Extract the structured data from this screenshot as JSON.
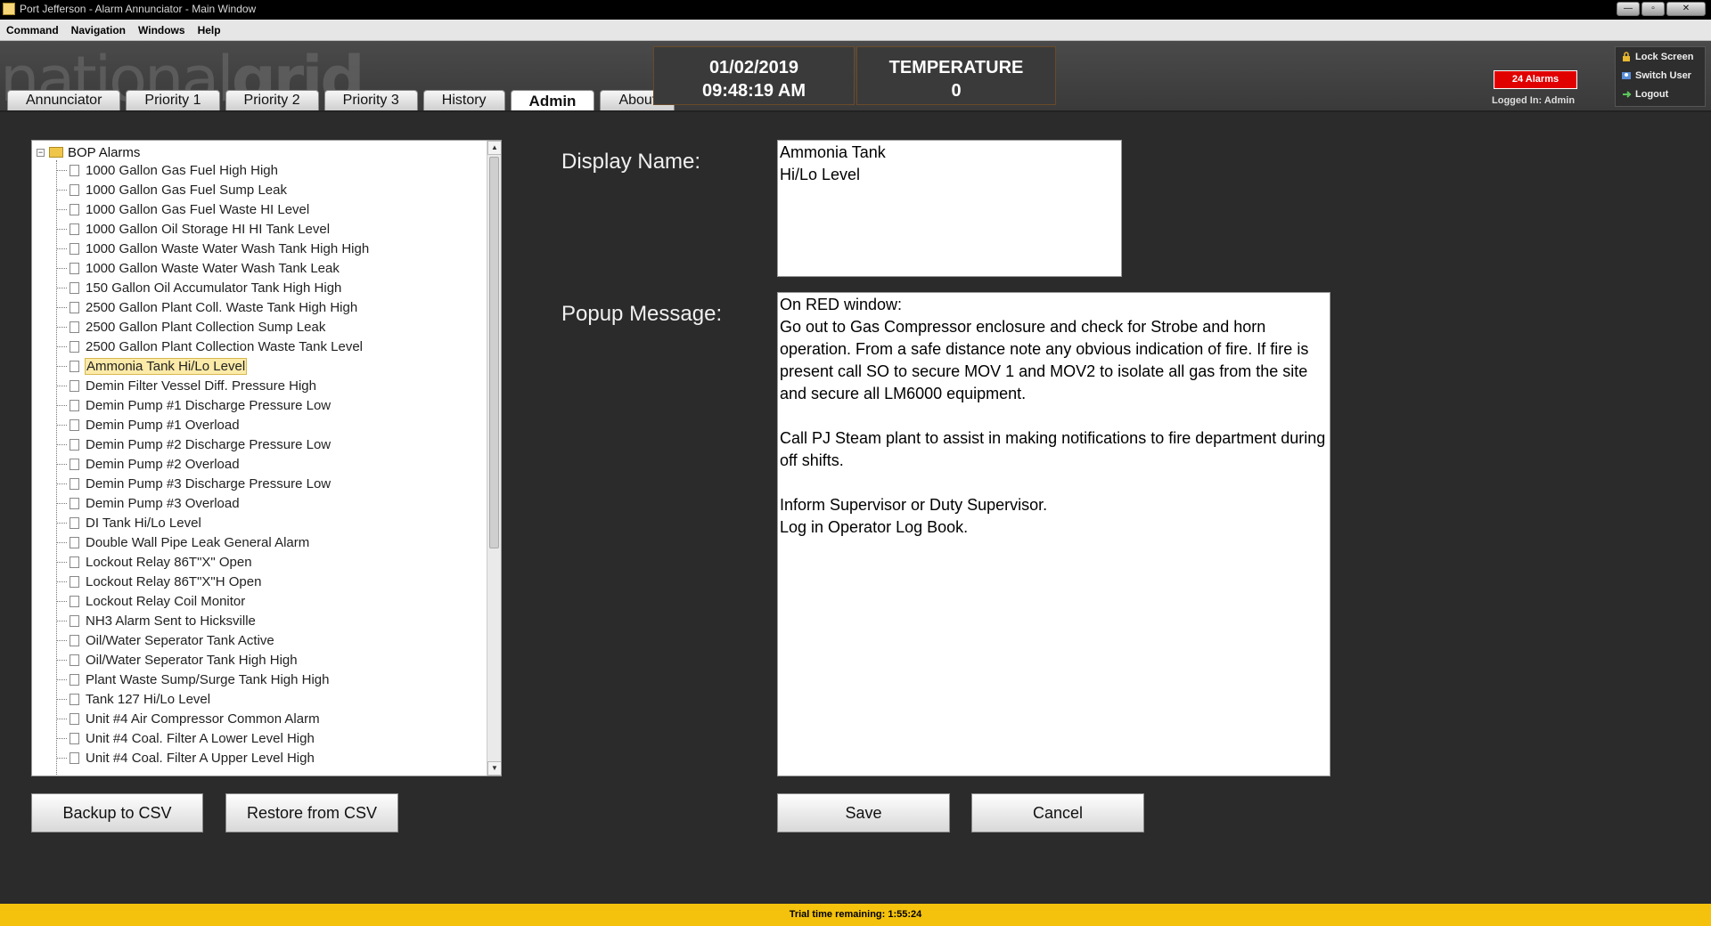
{
  "window": {
    "title": "Port Jefferson - Alarm Annunciator - Main Window",
    "buttons": [
      "—",
      "▫",
      "✕"
    ]
  },
  "menu": [
    "Command",
    "Navigation",
    "Windows",
    "Help"
  ],
  "header": {
    "logo_light": "national",
    "logo_bold": "grid",
    "tabs": [
      "Annunciator",
      "Priority 1",
      "Priority 2",
      "Priority 3",
      "History",
      "Admin",
      "About"
    ],
    "active_tab": "Admin",
    "date": "01/02/2019",
    "time": "09:48:19 AM",
    "temperature_label": "TEMPERATURE",
    "temperature_value": "0",
    "alarm_badge": "24 Alarms",
    "logged_in": "Logged In: Admin",
    "session": {
      "lock": "Lock Screen",
      "switch": "Switch User",
      "logout": "Logout"
    }
  },
  "tree": {
    "root": "BOP Alarms",
    "items": [
      "1000 Gallon Gas Fuel High High",
      "1000 Gallon Gas Fuel Sump Leak",
      "1000 Gallon Gas Fuel Waste HI Level",
      "1000 Gallon Oil Storage HI HI Tank Level",
      "1000 Gallon Waste Water Wash Tank High High",
      "1000 Gallon Waste Water Wash Tank Leak",
      "150 Gallon Oil Accumulator Tank High High",
      "2500 Gallon Plant Coll. Waste Tank High High",
      "2500 Gallon Plant Collection Sump Leak",
      "2500 Gallon Plant Collection Waste Tank Level",
      "Ammonia Tank Hi/Lo Level",
      "Demin Filter Vessel Diff. Pressure High",
      "Demin Pump #1 Discharge Pressure Low",
      "Demin Pump #1 Overload",
      "Demin Pump #2 Discharge Pressure Low",
      "Demin Pump #2 Overload",
      "Demin Pump #3 Discharge Pressure Low",
      "Demin Pump #3 Overload",
      "DI Tank Hi/Lo Level",
      "Double Wall Pipe Leak General Alarm",
      "Lockout Relay 86T\"X\" Open",
      "Lockout Relay 86T\"X\"H Open",
      "Lockout Relay Coil Monitor",
      "NH3 Alarm Sent to Hicksville",
      "Oil/Water Seperator Tank Active",
      "Oil/Water Seperator Tank High High",
      "Plant Waste Sump/Surge Tank High High",
      "Tank 127 Hi/Lo Level",
      "Unit #4 Air Compressor Common Alarm",
      "Unit #4 Coal. Filter A Lower Level High",
      "Unit #4 Coal. Filter A Upper Level High"
    ],
    "selected_index": 10
  },
  "buttons": {
    "backup": "Backup to CSV",
    "restore": "Restore from CSV",
    "save": "Save",
    "cancel": "Cancel"
  },
  "form": {
    "display_name_label": "Display Name:",
    "display_name_value": "Ammonia Tank\nHi/Lo Level",
    "popup_label": "Popup Message:",
    "popup_value": "On RED window:\nGo out to Gas Compressor enclosure and check for Strobe and horn operation. From a safe distance note any obvious indication of fire. If fire is present call SO to secure MOV 1 and MOV2 to isolate all gas from the site and secure all LM6000 equipment.\n\nCall PJ Steam plant to assist in making notifications to fire department during off shifts.\n\nInform Supervisor or Duty Supervisor.\nLog in Operator Log Book."
  },
  "footer": {
    "trial": "Trial time remaining: 1:55:24"
  }
}
